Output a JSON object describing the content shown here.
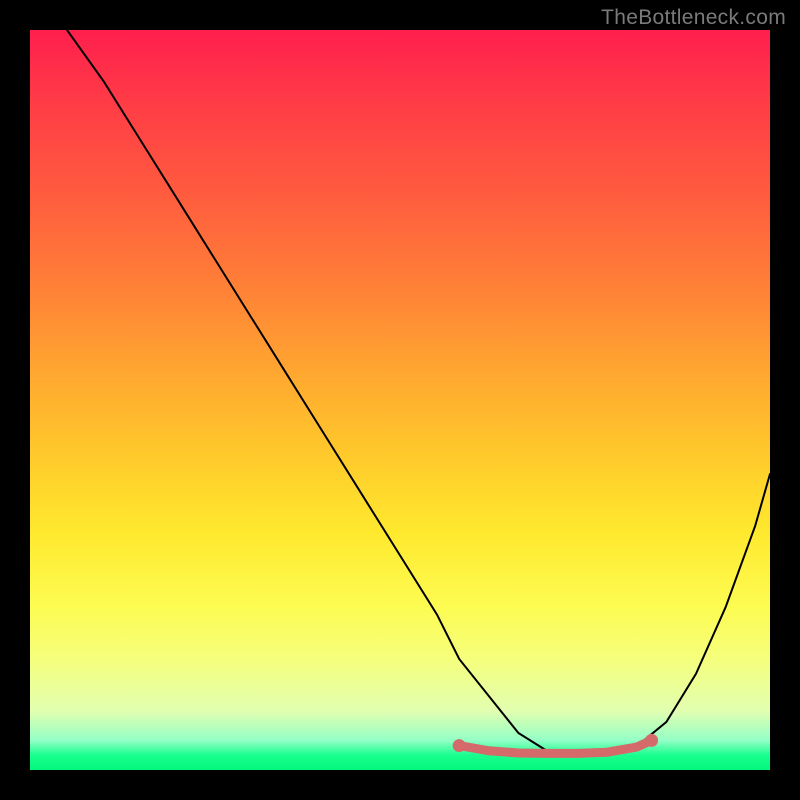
{
  "watermark": "TheBottleneck.com",
  "chart_data": {
    "type": "line",
    "title": "",
    "xlabel": "",
    "ylabel": "",
    "xlim": [
      0,
      100
    ],
    "ylim": [
      0,
      100
    ],
    "series": [
      {
        "name": "curve",
        "x": [
          5,
          10,
          15,
          20,
          25,
          30,
          35,
          40,
          45,
          50,
          55,
          58,
          62,
          66,
          70,
          72,
          74,
          78,
          82,
          86,
          90,
          94,
          98,
          100
        ],
        "y": [
          100,
          93,
          85,
          77,
          69,
          61,
          53,
          45,
          37,
          29,
          21,
          15,
          10,
          5,
          2.5,
          2.2,
          2.2,
          2.4,
          3.2,
          6.5,
          13,
          22,
          33,
          40
        ],
        "color": "#000000",
        "stroke_width": 2
      },
      {
        "name": "flat-highlight",
        "x": [
          58,
          62,
          66,
          70,
          74,
          78,
          82,
          84
        ],
        "y": [
          3.3,
          2.6,
          2.3,
          2.25,
          2.25,
          2.4,
          3.1,
          4.0
        ],
        "color": "#d46a6a",
        "stroke_width": 9
      }
    ],
    "highlight_endpoints": {
      "left": {
        "x": 58,
        "y": 3.3
      },
      "right": {
        "x": 84,
        "y": 4.0
      },
      "radius": 6,
      "color": "#d46a6a"
    },
    "gradient_stops": [
      {
        "pos": 0.0,
        "color": "#ff1f4d"
      },
      {
        "pos": 0.1,
        "color": "#ff3c46"
      },
      {
        "pos": 0.22,
        "color": "#ff5b3f"
      },
      {
        "pos": 0.34,
        "color": "#ff7e37"
      },
      {
        "pos": 0.46,
        "color": "#ffa630"
      },
      {
        "pos": 0.58,
        "color": "#ffcb2b"
      },
      {
        "pos": 0.68,
        "color": "#ffe92e"
      },
      {
        "pos": 0.78,
        "color": "#fdfc52"
      },
      {
        "pos": 0.85,
        "color": "#f5ff7c"
      },
      {
        "pos": 0.92,
        "color": "#e2ffb0"
      },
      {
        "pos": 0.96,
        "color": "#93ffc6"
      },
      {
        "pos": 0.98,
        "color": "#19ff8e"
      },
      {
        "pos": 1.0,
        "color": "#02f77b"
      }
    ]
  }
}
